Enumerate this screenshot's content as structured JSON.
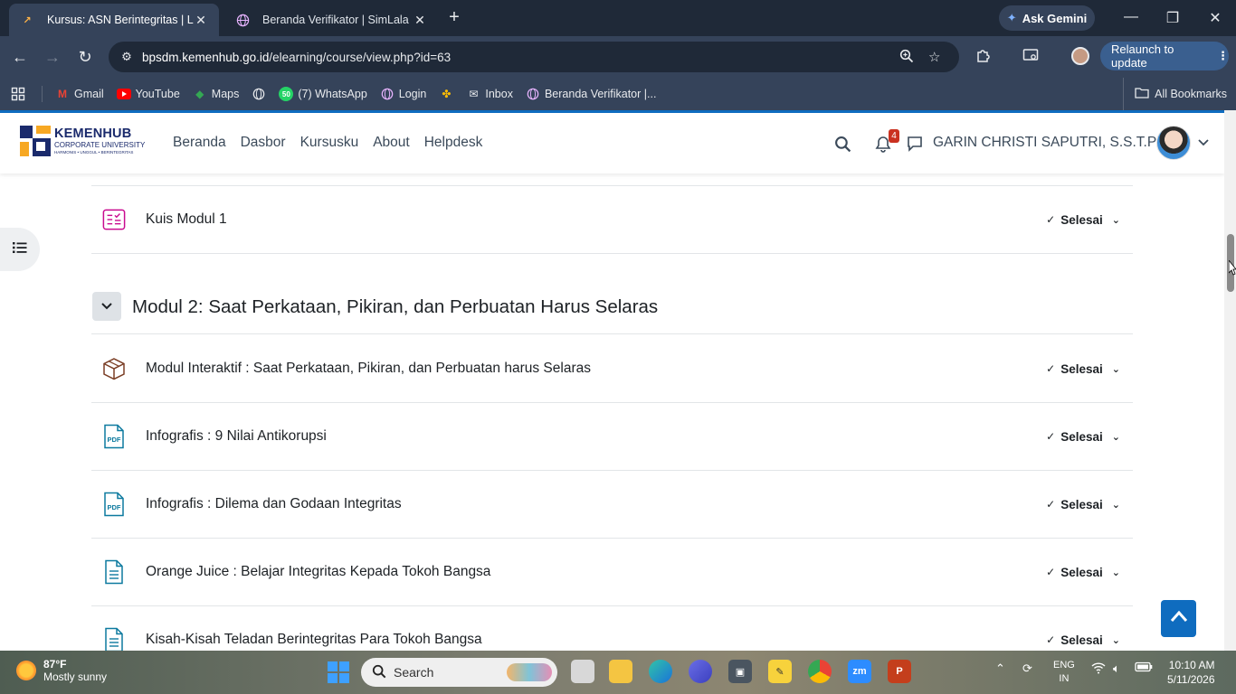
{
  "browser": {
    "tabs": [
      {
        "title": "Kursus: ASN Berintegritas | LMS",
        "active": true
      },
      {
        "title": "Beranda Verifikator | SimLala",
        "active": false
      }
    ],
    "new_tab": "+",
    "ask_gemini": "Ask Gemini",
    "url_host": "bpsdm.kemenhub.go.id",
    "url_path": "/elearning/course/view.php?id=63",
    "relaunch": "Relaunch to update",
    "bookmarks": [
      "Gmail",
      "YouTube",
      "Maps",
      "(7) WhatsApp",
      "Login",
      "Inbox",
      "Beranda Verifikator |..."
    ],
    "whatsapp_badge": "50",
    "all_bookmarks": "All Bookmarks"
  },
  "site": {
    "logo_title": "KEMENHUB",
    "logo_subtitle": "CORPORATE UNIVERSITY",
    "logo_tagline": "HARMONIS • UNGGUL • BERINTEGRITAS",
    "nav": [
      "Beranda",
      "Dasbor",
      "Kursusku",
      "About",
      "Helpdesk"
    ],
    "notification_count": "4",
    "user_name": "GARIN CHRISTI SAPUTRI, S.S.T.Pel"
  },
  "course": {
    "prev_activity": {
      "name": "Kuis Modul 1",
      "status": "Selesai",
      "icon": "quiz-icon"
    },
    "section_title": "Modul 2: Saat Perkataan, Pikiran, dan Perbuatan Harus Selaras",
    "activities": [
      {
        "name": "Modul Interaktif : Saat Perkataan, Pikiran, dan Perbuatan harus Selaras",
        "status": "Selesai",
        "icon": "package-icon"
      },
      {
        "name": "Infografis : 9 Nilai Antikorupsi",
        "status": "Selesai",
        "icon": "pdf-icon"
      },
      {
        "name": "Infografis : Dilema dan Godaan Integritas",
        "status": "Selesai",
        "icon": "pdf-icon"
      },
      {
        "name": "Orange Juice : Belajar Integritas Kepada Tokoh Bangsa",
        "status": "Selesai",
        "icon": "file-icon"
      },
      {
        "name": "Kisah-Kisah Teladan Berintegritas Para Tokoh Bangsa",
        "status": "Selesai",
        "icon": "file-icon"
      }
    ]
  },
  "taskbar": {
    "temperature": "87°F",
    "weather": "Mostly sunny",
    "search_placeholder": "Search",
    "lang_line1": "ENG",
    "lang_line2": "IN",
    "time": "10:10 AM",
    "date": "5/11/2026"
  },
  "colors": {
    "accent": "#0f6cbf",
    "quiz_icon": "#c90a8f",
    "pdf_icon": "#0d7a9f",
    "package_icon": "#7b3f26"
  }
}
